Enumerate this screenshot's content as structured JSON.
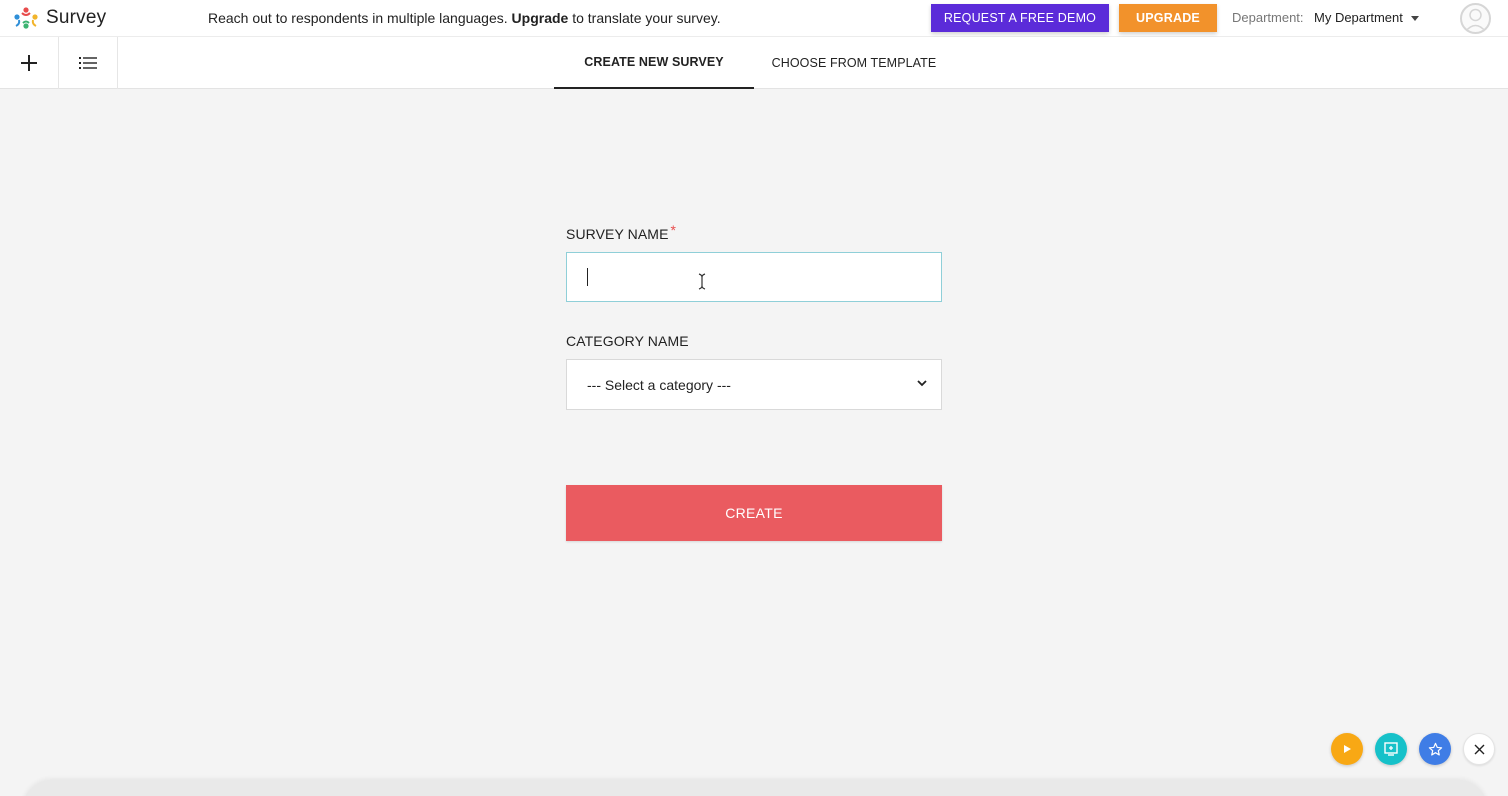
{
  "header": {
    "logo_text": "Survey",
    "promo_prefix": "Reach out to respondents in multiple languages. ",
    "promo_bold": "Upgrade",
    "promo_suffix": " to translate your survey.",
    "demo_button": "REQUEST A FREE DEMO",
    "upgrade_button": "UPGRADE",
    "department_label": "Department:",
    "department_value": "My Department"
  },
  "toolbar": {
    "icons": [
      "plus-icon",
      "list-icon"
    ]
  },
  "tabs": [
    {
      "label": "CREATE NEW SURVEY",
      "active": true
    },
    {
      "label": "CHOOSE FROM TEMPLATE",
      "active": false
    }
  ],
  "form": {
    "survey_name_label": "SURVEY NAME",
    "required_mark": "*",
    "survey_name_value": "",
    "category_label": "CATEGORY NAME",
    "category_selected": "--- Select a category ---",
    "create_button": "CREATE"
  },
  "widgets": [
    "play-icon",
    "board-icon",
    "star-icon",
    "close-icon"
  ],
  "colors": {
    "demo": "#5b2bd9",
    "upgrade": "#f2922b",
    "create": "#ea5b60",
    "input_focus_border": "#8fcfd8"
  }
}
